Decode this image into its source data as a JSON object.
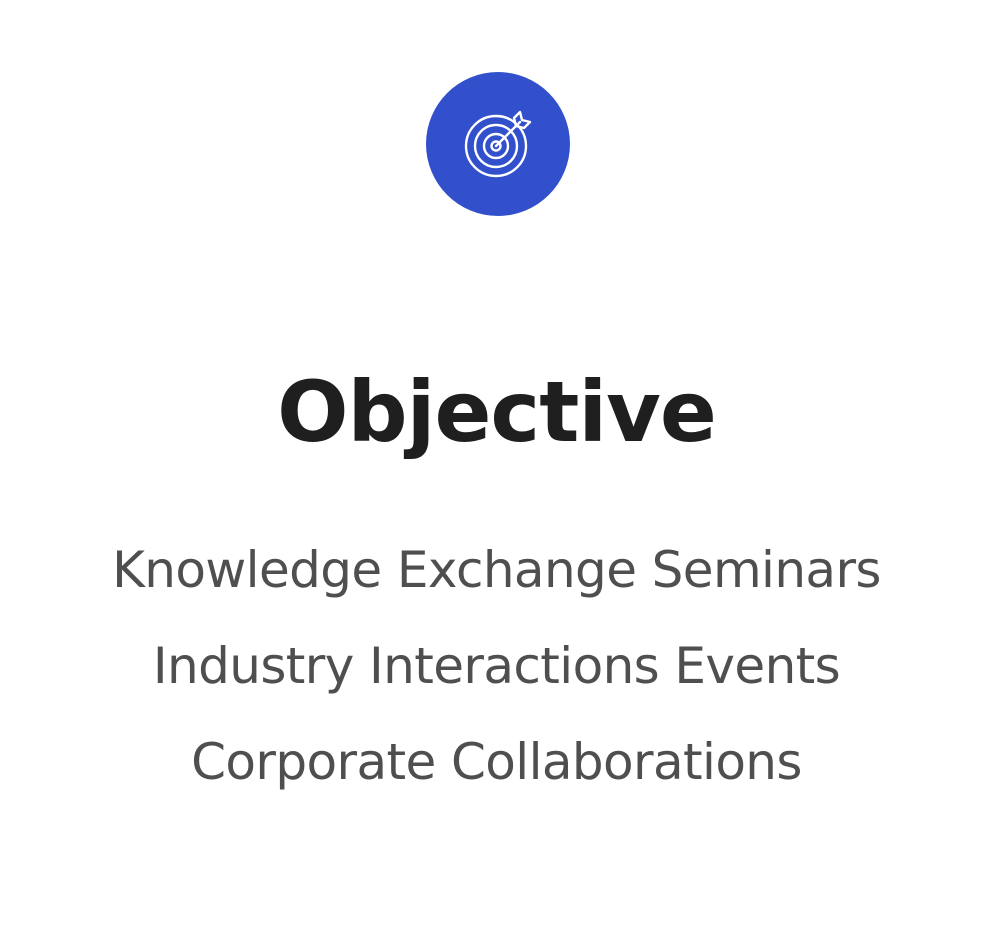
{
  "colors": {
    "accent": "#3350cc",
    "icon_stroke": "#ffffff",
    "title": "#1f1f1f",
    "body_text": "#4f4f4f",
    "background": "#ffffff"
  },
  "icon": {
    "name": "target-arrow-icon"
  },
  "title": "Objective",
  "items": [
    "Knowledge Exchange Seminars",
    "Industry Interactions Events",
    "Corporate Collaborations"
  ]
}
